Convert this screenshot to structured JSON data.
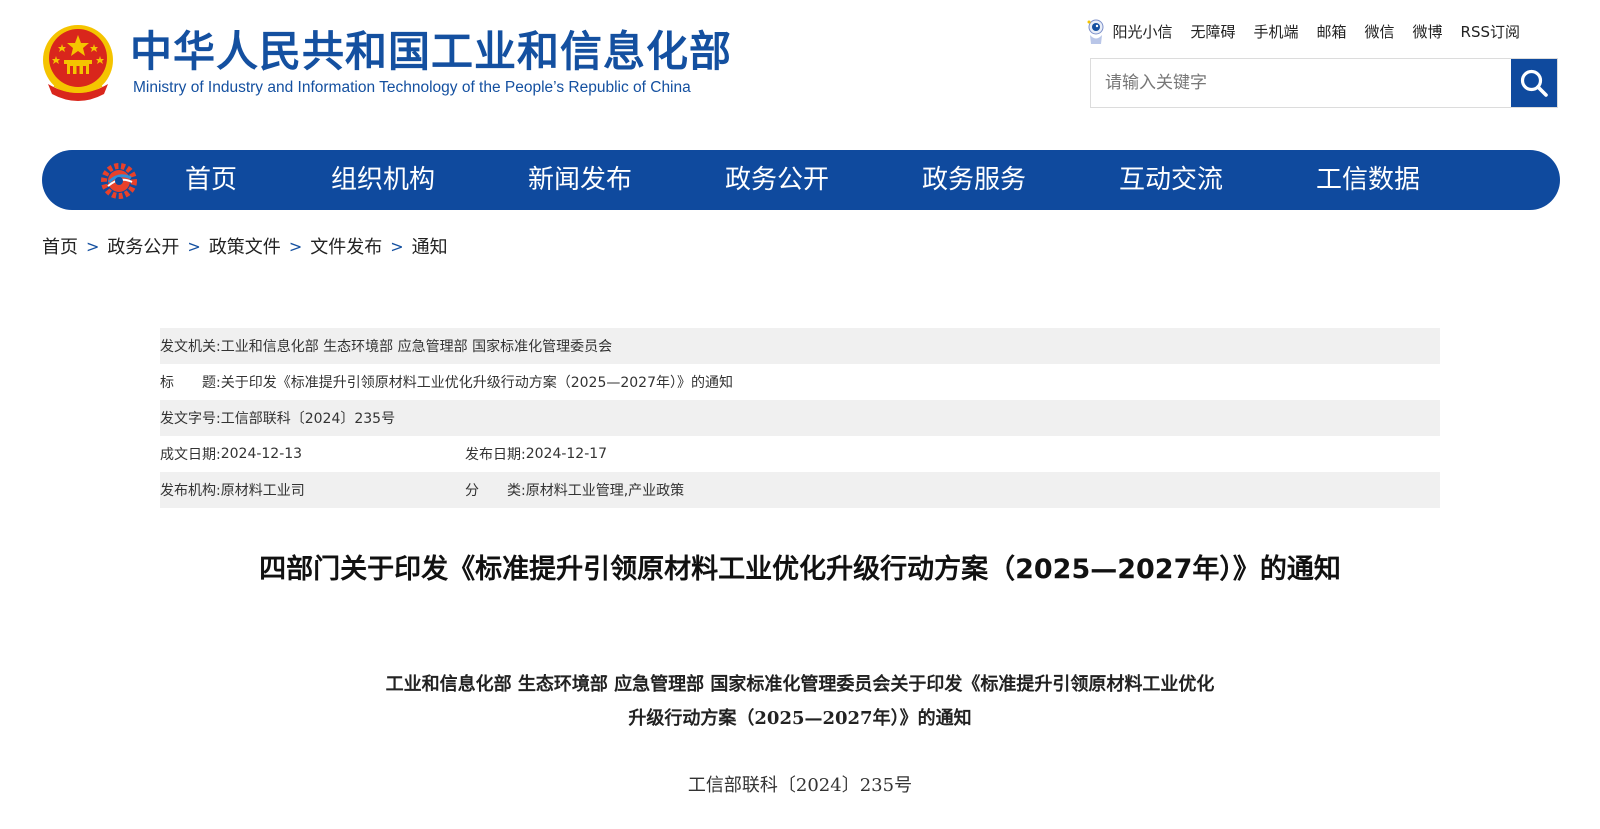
{
  "header": {
    "title": "中华人民共和国工业和信息化部",
    "subtitle": "Ministry of Industry and Information Technology of the People’s Republic of China",
    "emblem_icon": "national-emblem-icon"
  },
  "toplinks": {
    "mascot_icon": "mascot-icon",
    "items": [
      "阳光小信",
      "无障碍",
      "手机端",
      "邮箱",
      "微信",
      "微博",
      "RSS订阅"
    ]
  },
  "search": {
    "placeholder": "请输入关键字",
    "value": "",
    "icon": "search-icon"
  },
  "nav": {
    "logo_icon": "miit-logo-icon",
    "items": [
      "首页",
      "组织机构",
      "新闻发布",
      "政务公开",
      "政务服务",
      "互动交流",
      "工信数据"
    ]
  },
  "breadcrumb": {
    "items": [
      "首页",
      "政务公开",
      "政策文件",
      "文件发布",
      "通知"
    ],
    "separator": ">"
  },
  "meta": {
    "issuer_label": "发文机关:",
    "issuer": "工业和信息化部 生态环境部 应急管理部 国家标准化管理委员会",
    "title_label": "标　　题:",
    "title": "关于印发《标准提升引领原材料工业优化升级行动方案（2025—2027年）》的通知",
    "docno_label": "发文字号:",
    "docno": "工信部联科〔2024〕235号",
    "written_label": "成文日期:",
    "written": "2024-12-13",
    "published_label": "发布日期:",
    "published": "2024-12-17",
    "org_label": "发布机构:",
    "org": "原材料工业司",
    "category_label": "分　　类:",
    "category": "原材料工业管理,产业政策"
  },
  "article": {
    "title": "四部门关于印发《标准提升引领原材料工业优化升级行动方案（2025—2027年）》的通知",
    "heading_line1": "工业和信息化部 生态环境部 应急管理部 国家标准化管理委员会关于印发《标准提升引领原材料工业优化",
    "heading_line2": "升级行动方案（2025—2027年）》的通知",
    "doc_number": "工信部联科〔2024〕235号"
  },
  "colors": {
    "brand_blue": "#0f4a9e",
    "title_blue": "#1450a0",
    "emblem_red": "#d9261c",
    "emblem_gold": "#f5c400",
    "shade_gray": "#f0f0f0"
  }
}
